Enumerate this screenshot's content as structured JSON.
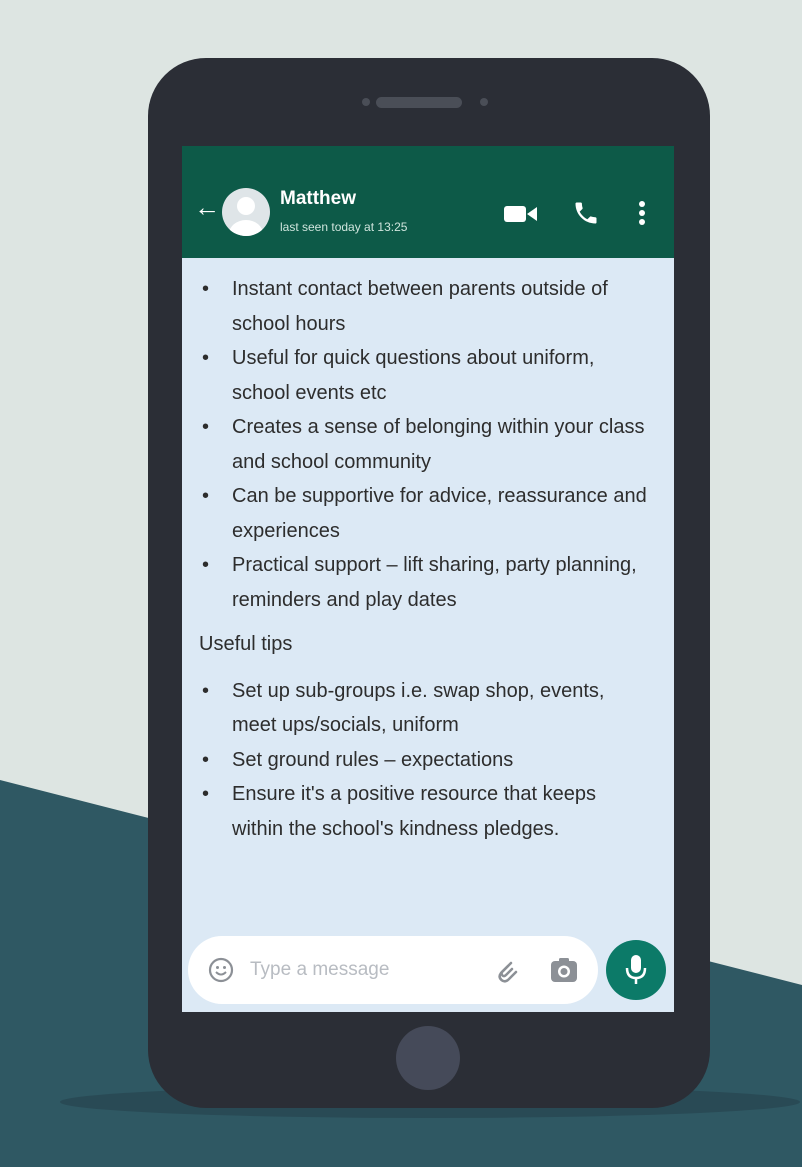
{
  "contact": {
    "name": "Matthew",
    "status": "last seen today at 13:25"
  },
  "message": {
    "bullets": [
      "Instant contact between parents outside of school hours",
      "Useful for quick questions about uniform, school events etc",
      "Creates a sense of belonging within your class and school community",
      "Can be supportive for advice, reassurance and experiences",
      "Practical support – lift sharing, party planning, reminders and play dates"
    ],
    "tips_heading": "Useful tips",
    "tips": [
      "Set up sub-groups i.e. swap shop, events, meet ups/socials, uniform",
      "Set ground rules – expectations",
      "Ensure it's a positive resource that keeps within the school's kindness pledges."
    ]
  },
  "composer": {
    "placeholder": "Type a message"
  },
  "icons": {
    "back": "arrow-left-icon",
    "avatar": "user-avatar-icon",
    "video": "video-camera-icon",
    "call": "phone-icon",
    "menu": "more-vertical-icon",
    "emoji": "emoji-icon",
    "attach": "paperclip-icon",
    "camera": "camera-icon",
    "mic": "microphone-icon"
  },
  "colors": {
    "header": "#0d5a48",
    "chat_bg": "#dce9f5",
    "mic_button": "#0c7a68",
    "phone_body": "#2b2e36",
    "backdrop_light": "#dde5e2",
    "backdrop_dark": "#2f5863"
  }
}
